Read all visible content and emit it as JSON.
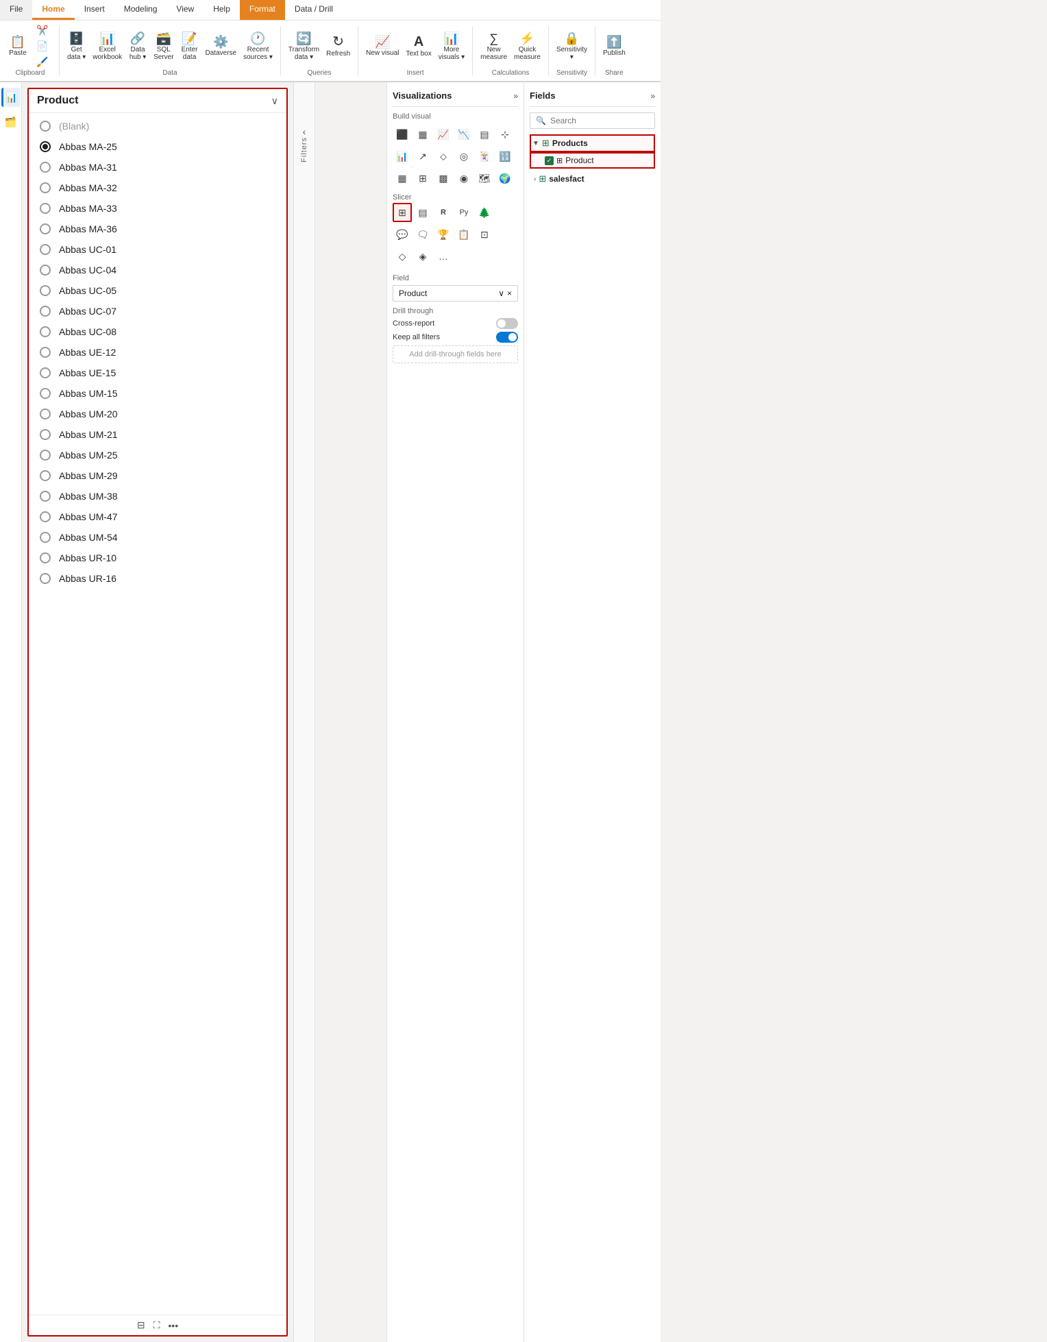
{
  "ribbon": {
    "tabs": [
      {
        "id": "file",
        "label": "File",
        "active": false
      },
      {
        "id": "home",
        "label": "Home",
        "active": true
      },
      {
        "id": "insert",
        "label": "Insert",
        "active": false
      },
      {
        "id": "modeling",
        "label": "Modeling",
        "active": false
      },
      {
        "id": "view",
        "label": "View",
        "active": false
      },
      {
        "id": "help",
        "label": "Help",
        "active": false
      },
      {
        "id": "format",
        "label": "Format",
        "active": true,
        "format": true
      },
      {
        "id": "datadrill",
        "label": "Data / Drill",
        "active": false,
        "data": true
      }
    ],
    "groups": {
      "clipboard": {
        "label": "Clipboard",
        "items": [
          {
            "id": "paste",
            "icon": "📋",
            "label": "Paste"
          },
          {
            "id": "cut",
            "icon": "✂️",
            "label": ""
          },
          {
            "id": "copy",
            "icon": "📄",
            "label": ""
          }
        ]
      },
      "data": {
        "label": "Data",
        "items": [
          {
            "id": "get-data",
            "icon": "🗄️",
            "label": "Get data ▾"
          },
          {
            "id": "excel",
            "icon": "📊",
            "label": "Excel workbook"
          },
          {
            "id": "datahub",
            "icon": "🔗",
            "label": "Data hub ▾"
          },
          {
            "id": "sqlserver",
            "icon": "🗃️",
            "label": "SQL Server"
          },
          {
            "id": "enterdata",
            "icon": "📝",
            "label": "Enter data"
          },
          {
            "id": "dataverse",
            "icon": "⚙️",
            "label": "Dataverse"
          },
          {
            "id": "recent",
            "icon": "🕐",
            "label": "Recent sources ▾"
          }
        ]
      },
      "queries": {
        "label": "Queries",
        "items": [
          {
            "id": "transform",
            "icon": "🔄",
            "label": "Transform data ▾"
          },
          {
            "id": "refresh",
            "icon": "↻",
            "label": "Refresh"
          }
        ]
      },
      "insert": {
        "label": "Insert",
        "items": [
          {
            "id": "new-visual",
            "icon": "📈",
            "label": "New visual"
          },
          {
            "id": "textbox",
            "icon": "A",
            "label": "Text box"
          },
          {
            "id": "more-visuals",
            "icon": "📊",
            "label": "More visuals ▾"
          }
        ]
      },
      "calculations": {
        "label": "Calculations",
        "items": [
          {
            "id": "new-measure",
            "icon": "∑",
            "label": "New measure"
          },
          {
            "id": "quick-measure",
            "icon": "⚡",
            "label": "Quick measure"
          }
        ]
      },
      "sensitivity": {
        "label": "Sensitivity",
        "items": [
          {
            "id": "sensitivity-btn",
            "icon": "🔒",
            "label": "Sensitivity ▾"
          }
        ]
      },
      "share": {
        "label": "Share",
        "items": [
          {
            "id": "publish",
            "icon": "⬆️",
            "label": "Publish"
          }
        ]
      }
    }
  },
  "sidebar": {
    "icons": [
      {
        "id": "report",
        "icon": "📊",
        "active": true
      },
      {
        "id": "data",
        "icon": "🗂️",
        "active": false
      }
    ]
  },
  "slicer": {
    "title": "Product",
    "items": [
      {
        "id": "blank",
        "label": "(Blank)",
        "selected": false,
        "blank": true
      },
      {
        "id": "abbas-ma-25",
        "label": "Abbas MA-25",
        "selected": true
      },
      {
        "id": "abbas-ma-31",
        "label": "Abbas MA-31",
        "selected": false
      },
      {
        "id": "abbas-ma-32",
        "label": "Abbas MA-32",
        "selected": false
      },
      {
        "id": "abbas-ma-33",
        "label": "Abbas MA-33",
        "selected": false
      },
      {
        "id": "abbas-ma-36",
        "label": "Abbas MA-36",
        "selected": false
      },
      {
        "id": "abbas-uc-01",
        "label": "Abbas UC-01",
        "selected": false
      },
      {
        "id": "abbas-uc-04",
        "label": "Abbas UC-04",
        "selected": false
      },
      {
        "id": "abbas-uc-05",
        "label": "Abbas UC-05",
        "selected": false
      },
      {
        "id": "abbas-uc-07",
        "label": "Abbas UC-07",
        "selected": false
      },
      {
        "id": "abbas-uc-08",
        "label": "Abbas UC-08",
        "selected": false
      },
      {
        "id": "abbas-ue-12",
        "label": "Abbas UE-12",
        "selected": false
      },
      {
        "id": "abbas-ue-15",
        "label": "Abbas UE-15",
        "selected": false
      },
      {
        "id": "abbas-um-15",
        "label": "Abbas UM-15",
        "selected": false
      },
      {
        "id": "abbas-um-20",
        "label": "Abbas UM-20",
        "selected": false
      },
      {
        "id": "abbas-um-21",
        "label": "Abbas UM-21",
        "selected": false
      },
      {
        "id": "abbas-um-25",
        "label": "Abbas UM-25",
        "selected": false
      },
      {
        "id": "abbas-um-29",
        "label": "Abbas UM-29",
        "selected": false
      },
      {
        "id": "abbas-um-38",
        "label": "Abbas UM-38",
        "selected": false
      },
      {
        "id": "abbas-um-47",
        "label": "Abbas UM-47",
        "selected": false
      },
      {
        "id": "abbas-um-54",
        "label": "Abbas UM-54",
        "selected": false
      },
      {
        "id": "abbas-ur-10",
        "label": "Abbas UR-10",
        "selected": false
      },
      {
        "id": "abbas-ur-16",
        "label": "Abbas UR-16",
        "selected": false
      }
    ],
    "footer_icons": [
      "filter",
      "expand",
      "more"
    ]
  },
  "filter_panel": {
    "label": "Filters",
    "arrow": "‹"
  },
  "visualizations": {
    "title": "Visualizations",
    "expand_icon": "»",
    "build_label": "Build visual",
    "slicer_label": "Slicer",
    "viz_rows": [
      [
        "bar-clustered",
        "bar-stacked",
        "line",
        "area",
        "combo",
        "scatter",
        "pie"
      ],
      [
        "line2",
        "area2",
        "bar2",
        "waterfall",
        "funnel",
        "gauge",
        "card"
      ],
      [
        "table",
        "matrix",
        "treemap",
        "donut",
        "map",
        "filled-map",
        "key-influencer"
      ],
      [
        "slicer-active",
        "table2",
        "R-script",
        "python",
        "decomp-tree",
        "ai-narr",
        "smart-narr"
      ],
      [
        "q-and-a",
        "chat",
        "trophy",
        "chart3",
        "tiles"
      ],
      [
        "shape",
        "diamond",
        "more"
      ]
    ],
    "field": {
      "label": "Field",
      "value": "Product",
      "actions": [
        "chevron-down",
        "x"
      ]
    },
    "drill_through": {
      "label": "Drill through",
      "cross_report": {
        "label": "Cross-report",
        "state": "off"
      },
      "keep_filters": {
        "label": "Keep all filters",
        "state": "on"
      },
      "add_label": "Add drill-through fields here"
    }
  },
  "fields": {
    "title": "Fields",
    "expand_icon": "»",
    "search_placeholder": "Search",
    "tree": [
      {
        "id": "products",
        "label": "Products",
        "icon": "table",
        "expanded": true,
        "highlighted": true,
        "children": [
          {
            "id": "product",
            "label": "Product",
            "checked": true,
            "highlighted": true
          }
        ]
      },
      {
        "id": "salesfact",
        "label": "salesfact",
        "icon": "table",
        "expanded": false,
        "children": []
      }
    ]
  }
}
